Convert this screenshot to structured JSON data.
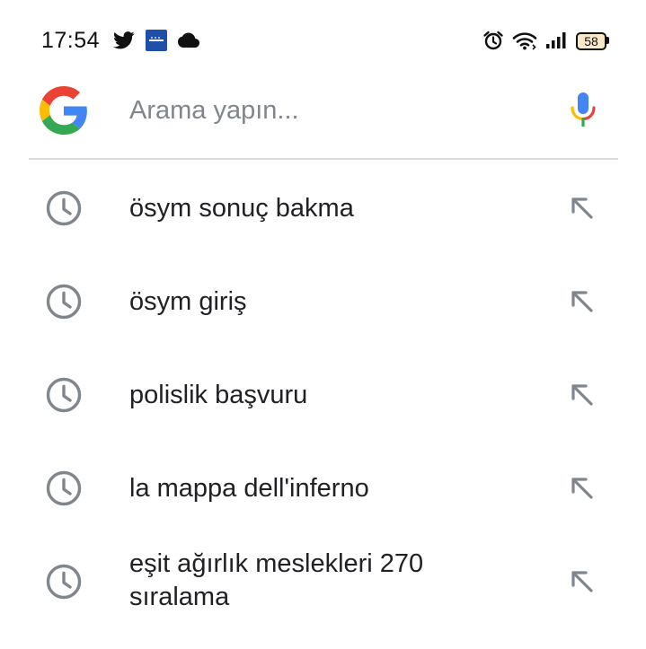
{
  "status_bar": {
    "time": "17:54",
    "left_icons": [
      "twitter-icon",
      "app-badge-icon",
      "cloud-icon"
    ],
    "right_icons": [
      "alarm-icon",
      "wifi-icon",
      "signal-icon"
    ],
    "battery": "58"
  },
  "search": {
    "placeholder": "Arama yapın..."
  },
  "suggestions": [
    {
      "text": "ösym sonuç bakma"
    },
    {
      "text": "ösym giriş"
    },
    {
      "text": "polislik başvuru"
    },
    {
      "text": "la mappa dell'inferno"
    },
    {
      "text": "eşit ağırlık meslekleri 270 sıralama"
    }
  ],
  "colors": {
    "google_blue": "#4285F4",
    "google_red": "#EA4335",
    "google_yellow": "#FBBC05",
    "google_green": "#34A853",
    "icon_gray": "#80868b",
    "text": "#202124"
  }
}
